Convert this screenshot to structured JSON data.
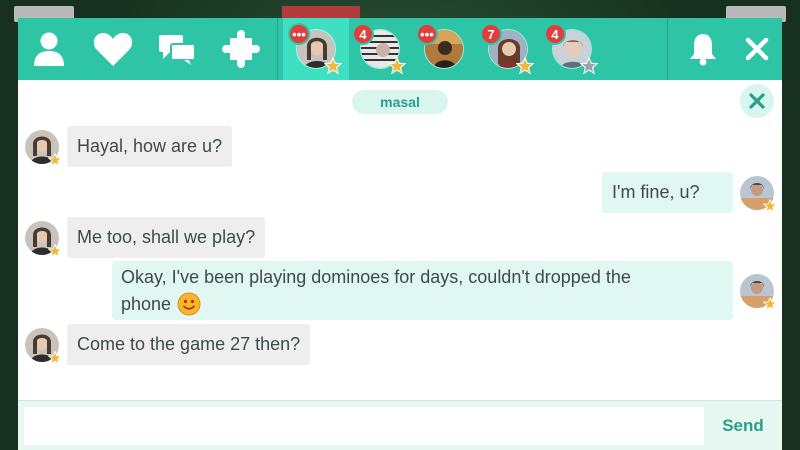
{
  "header": {
    "icons": [
      "profile-icon",
      "favorites-heart-icon",
      "chats-icon",
      "puzzle-icon"
    ],
    "right_icons": [
      "bell-icon",
      "close-icon"
    ],
    "conversation_tabs": [
      {
        "badge": "•••",
        "star": "gold",
        "active": true
      },
      {
        "badge": "4",
        "star": "gold",
        "active": false
      },
      {
        "badge": "•••",
        "star": "none",
        "active": false
      },
      {
        "badge": "7",
        "star": "gold",
        "active": false
      },
      {
        "badge": "4",
        "star": "gray",
        "active": false
      }
    ]
  },
  "chat": {
    "contact_name": "masal",
    "messages": [
      {
        "side": "in",
        "text": "Hayal, how are u?"
      },
      {
        "side": "out",
        "text": "I'm fine, u?"
      },
      {
        "side": "in",
        "text": "Me too, shall we play?"
      },
      {
        "side": "out",
        "text": "Okay, I've been playing dominoes for days, couldn't dropped the",
        "text2": "phone",
        "emoji": "smiley-emoji"
      },
      {
        "side": "in",
        "text": "Come to the game 27 then?"
      }
    ]
  },
  "composer": {
    "placeholder": "",
    "value": "",
    "send_label": "Send"
  },
  "colors": {
    "header": "#2ec4a6",
    "active_tab": "#3fe0c1",
    "accent_text": "#27a087",
    "badge": "#e23d3d",
    "bubble_in": "#eeeeee",
    "bubble_out": "#e1f7f1",
    "star_gold": "#f2b83a"
  }
}
